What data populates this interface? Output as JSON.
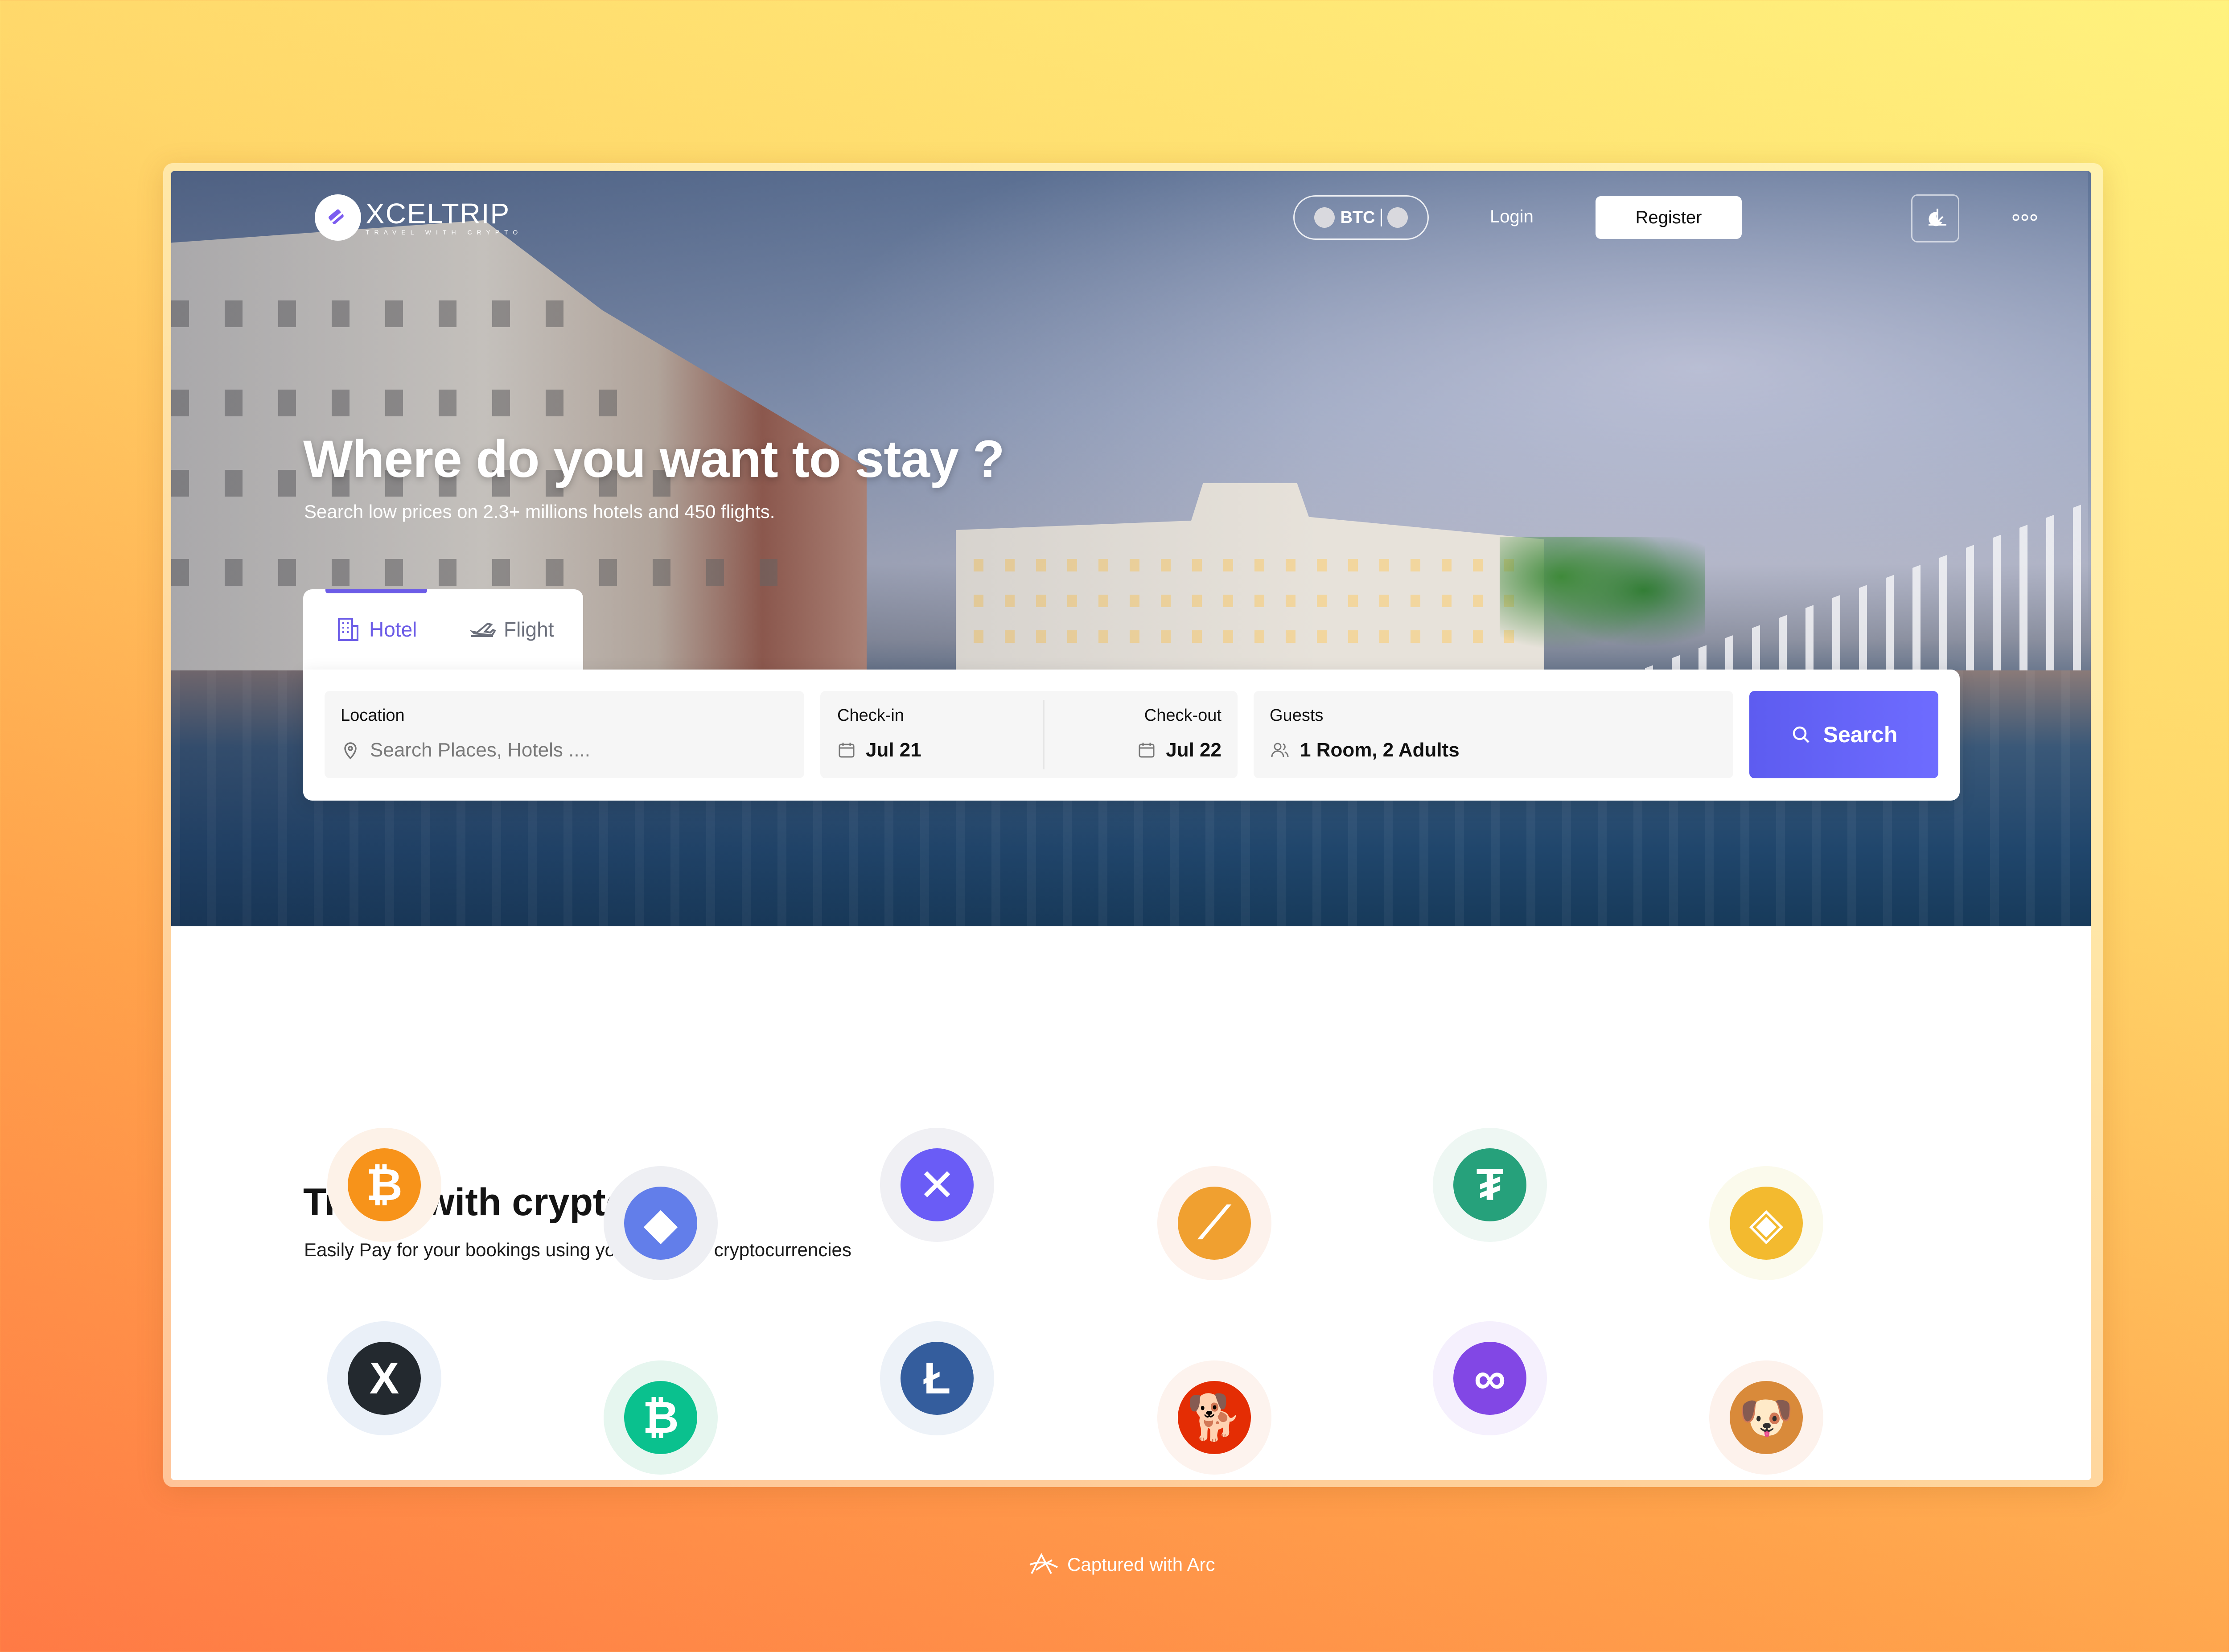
{
  "brand": {
    "name": "XCELTRIP",
    "tagline": "TRAVEL WITH CRYPTO"
  },
  "nav": {
    "currency": "BTC",
    "login": "Login",
    "register": "Register",
    "icons": [
      "download-icon",
      "more-icon",
      "moon-icon"
    ]
  },
  "hero": {
    "title": "Where do you want to stay ?",
    "subtitle": "Search low prices on 2.3+ millions hotels and 450 flights."
  },
  "search": {
    "tabs": [
      {
        "label": "Hotel",
        "active": true
      },
      {
        "label": "Flight",
        "active": false
      }
    ],
    "location": {
      "label": "Location",
      "placeholder": "Search Places, Hotels ...."
    },
    "checkin": {
      "label": "Check-in",
      "value": "Jul 21"
    },
    "checkout": {
      "label": "Check-out",
      "value": "Jul 22"
    },
    "guests": {
      "label": "Guests",
      "value": "1 Room, 2 Adults"
    },
    "button": "Search",
    "accent": "#6c5ce7"
  },
  "crypto": {
    "title": "Travel with crypto",
    "subtitle": "Easily Pay for your bookings using your favourite cryptocurrencies",
    "coins": [
      {
        "name": "bitcoin",
        "symbol": "₿",
        "color": "#f7931a",
        "bg": "#fdf2e8"
      },
      {
        "name": "ethereum",
        "symbol": "◆",
        "color": "#627eea",
        "bg": "#eeeff3"
      },
      {
        "name": "xceltoken",
        "symbol": "✕",
        "color": "#6a5cf6",
        "bg": "#f0f0f4"
      },
      {
        "name": "aragon",
        "symbol": "⟋",
        "color": "#f0a030",
        "bg": "#fdf2ec"
      },
      {
        "name": "tether",
        "symbol": "₮",
        "color": "#26a17b",
        "bg": "#eef7f3"
      },
      {
        "name": "binance",
        "symbol": "◈",
        "color": "#f3ba2f",
        "bg": "#fbfaec"
      },
      {
        "name": "xrp",
        "symbol": "X",
        "color": "#23292f",
        "bg": "#eaf0f8"
      },
      {
        "name": "bitcoin-cash",
        "symbol": "₿",
        "color": "#0ac18e",
        "bg": "#e6f6ef"
      },
      {
        "name": "litecoin",
        "symbol": "Ł",
        "color": "#345d9d",
        "bg": "#edf2f8"
      },
      {
        "name": "shiba-inu",
        "symbol": "🐕",
        "color": "#e42d04",
        "bg": "#fdf3ee"
      },
      {
        "name": "polygon",
        "symbol": "∞",
        "color": "#8247e5",
        "bg": "#f5f0fd"
      },
      {
        "name": "baby-doge",
        "symbol": "🐶",
        "color": "#d98a3a",
        "bg": "#fdf2ec"
      }
    ]
  },
  "footer": {
    "text": "Captured with Arc"
  }
}
